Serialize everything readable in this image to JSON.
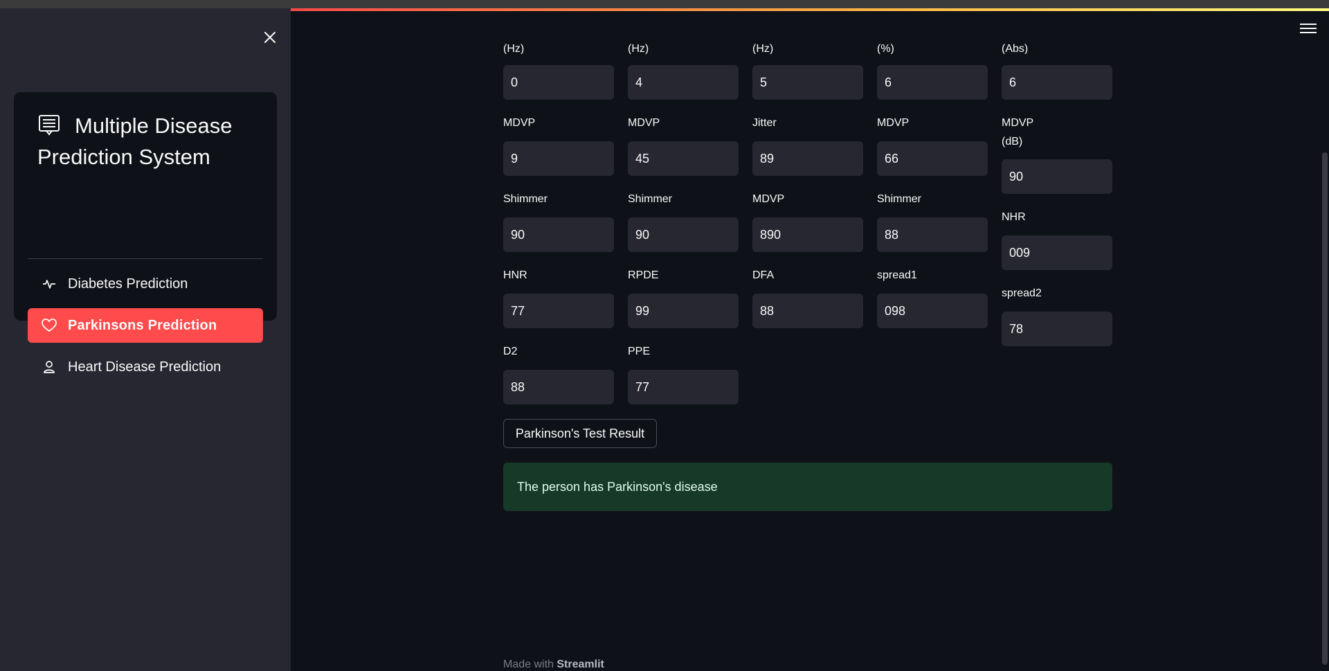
{
  "sidebar": {
    "close_icon": "close-icon",
    "title": "Multiple Disease Prediction System",
    "title_icon": "document-list-icon",
    "items": [
      {
        "label": "Diabetes Prediction",
        "icon": "activity-icon",
        "active": false
      },
      {
        "label": "Parkinsons Prediction",
        "icon": "heart-icon",
        "active": true
      },
      {
        "label": "Heart Disease Prediction",
        "icon": "person-icon",
        "active": false
      }
    ],
    "accent_color": "#ff4b4b"
  },
  "top_labels": [
    "(Hz)",
    "(Hz)",
    "(Hz)",
    "(%)",
    "(Abs)"
  ],
  "fields": {
    "row1": [
      {
        "value": "0"
      },
      {
        "value": "4"
      },
      {
        "value": "5"
      },
      {
        "value": "6"
      },
      {
        "value": "6"
      }
    ],
    "row2": [
      {
        "label": "MDVP",
        "value": "9"
      },
      {
        "label": "MDVP",
        "value": "45"
      },
      {
        "label": "Jitter",
        "value": "89"
      },
      {
        "label": "MDVP",
        "value": "66"
      },
      {
        "label": "MDVP",
        "label2": "(dB)",
        "value": "90"
      }
    ],
    "row3": [
      {
        "label": "Shimmer",
        "value": "90"
      },
      {
        "label": "Shimmer",
        "value": "90"
      },
      {
        "label": "MDVP",
        "value": "890"
      },
      {
        "label": "Shimmer",
        "value": "88"
      },
      {
        "label": "NHR",
        "value": "009"
      }
    ],
    "row4": [
      {
        "label": "HNR",
        "value": "77"
      },
      {
        "label": "RPDE",
        "value": "99"
      },
      {
        "label": "DFA",
        "value": "88"
      },
      {
        "label": "spread1",
        "value": "098"
      },
      {
        "label": "spread2",
        "value": "78"
      }
    ],
    "row5": [
      {
        "label": "D2",
        "value": "88"
      },
      {
        "label": "PPE",
        "value": "77"
      }
    ]
  },
  "button_label": "Parkinson's Test Result",
  "result_message": "The person has Parkinson's disease",
  "footer": {
    "prefix": "Made with ",
    "link": "Streamlit"
  }
}
